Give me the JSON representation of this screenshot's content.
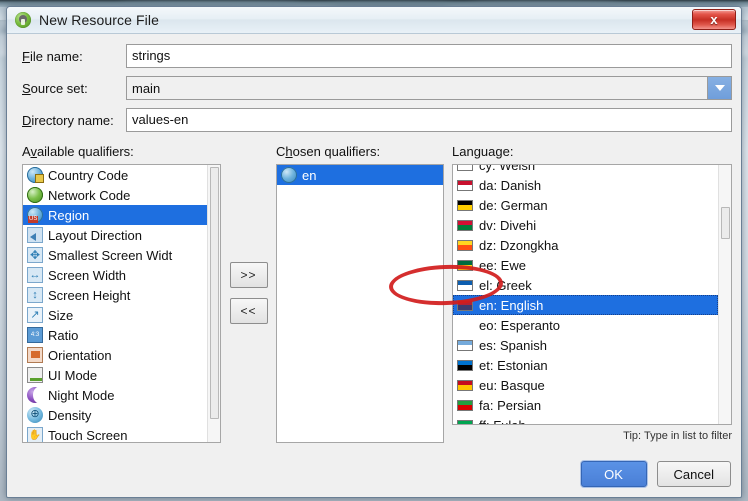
{
  "window": {
    "title": "New Resource File",
    "app_icon": "android-studio-icon",
    "close_label": "x"
  },
  "form": {
    "file_name": {
      "label_pre": "F",
      "label_post": "ile name:",
      "value": "strings"
    },
    "source_set": {
      "label_pre": "S",
      "label_post": "ource set:",
      "value": "main"
    },
    "directory_name": {
      "label_pre": "D",
      "label_post": "irectory name:",
      "value": "values-en"
    }
  },
  "available_qualifiers": {
    "label_pre": "A",
    "label_mid": "v",
    "label_post": "ailable qualifiers:",
    "items": [
      {
        "label": "Country Code",
        "icon": "globe-badge-icon",
        "selected": false
      },
      {
        "label": "Network Code",
        "icon": "globe-green-icon",
        "selected": false
      },
      {
        "label": "Region",
        "icon": "globe-us-icon",
        "selected": true
      },
      {
        "label": "Layout Direction",
        "icon": "arrow-left-icon",
        "selected": false
      },
      {
        "label": "Smallest Screen Widt",
        "icon": "four-arrow-icon",
        "selected": false
      },
      {
        "label": "Screen Width",
        "icon": "horizontal-width-icon",
        "selected": false
      },
      {
        "label": "Screen Height",
        "icon": "vertical-height-icon",
        "selected": false
      },
      {
        "label": "Size",
        "icon": "diagonal-size-icon",
        "selected": false
      },
      {
        "label": "Ratio",
        "icon": "ratio-icon",
        "selected": false
      },
      {
        "label": "Orientation",
        "icon": "orientation-icon",
        "selected": false
      },
      {
        "label": "UI Mode",
        "icon": "ui-mode-icon",
        "selected": false
      },
      {
        "label": "Night Mode",
        "icon": "night-mode-icon",
        "selected": false
      },
      {
        "label": "Density",
        "icon": "density-icon",
        "selected": false
      },
      {
        "label": "Touch Screen",
        "icon": "touch-screen-icon",
        "selected": false
      }
    ]
  },
  "transfer_buttons": {
    "add_label": ">>",
    "remove_label": "<<"
  },
  "chosen_qualifiers": {
    "label_pre": "C",
    "label_mid": "h",
    "label_post": "osen qualifiers:",
    "items": [
      {
        "label": "en",
        "icon": "globe-icon",
        "selected": true
      }
    ]
  },
  "language": {
    "label": "Language:",
    "tip": "Tip: Type in list to filter",
    "items": [
      {
        "label": "cy: Welsh",
        "flag": "#2f7d3a",
        "flag2": "#ffffff",
        "selected": false,
        "clipped": true
      },
      {
        "label": "da: Danish",
        "flag": "#c8102e",
        "flag2": "#ffffff",
        "selected": false
      },
      {
        "label": "de: German",
        "flag": "#000000",
        "flag2": "#ffce00",
        "selected": false
      },
      {
        "label": "dv: Divehi",
        "flag": "#d21034",
        "flag2": "#007e3a",
        "selected": false
      },
      {
        "label": "dz: Dzongkha",
        "flag": "#ffd520",
        "flag2": "#ff4e12",
        "selected": false
      },
      {
        "label": "ee: Ewe",
        "flag": "#006b3f",
        "flag2": "#fcd20f",
        "selected": false
      },
      {
        "label": "el: Greek",
        "flag": "#0d5eaf",
        "flag2": "#ffffff",
        "selected": false
      },
      {
        "label": "en: English",
        "flag": "#b22234",
        "flag2": "#3c3b6e",
        "selected": true
      },
      {
        "label": "eo: Esperanto",
        "flag": "",
        "flag2": "",
        "selected": false,
        "noflag": true
      },
      {
        "label": "es: Spanish",
        "flag": "#75aadb",
        "flag2": "#ffffff",
        "selected": false
      },
      {
        "label": "et: Estonian",
        "flag": "#0072ce",
        "flag2": "#000000",
        "selected": false
      },
      {
        "label": "eu: Basque",
        "flag": "#c60b1e",
        "flag2": "#ffc400",
        "selected": false
      },
      {
        "label": "fa: Persian",
        "flag": "#239f40",
        "flag2": "#da0000",
        "selected": false
      },
      {
        "label": "ff: Fulah",
        "flag": "#00a550",
        "flag2": "#ffd100",
        "selected": false
      }
    ]
  },
  "footer": {
    "ok_label": "OK",
    "cancel_label": "Cancel"
  },
  "colors": {
    "selection_blue": "#1e6fe0",
    "primary_button": "#4a7fd6",
    "annotation_red": "#d11c1c",
    "close_red": "#c62f24"
  }
}
